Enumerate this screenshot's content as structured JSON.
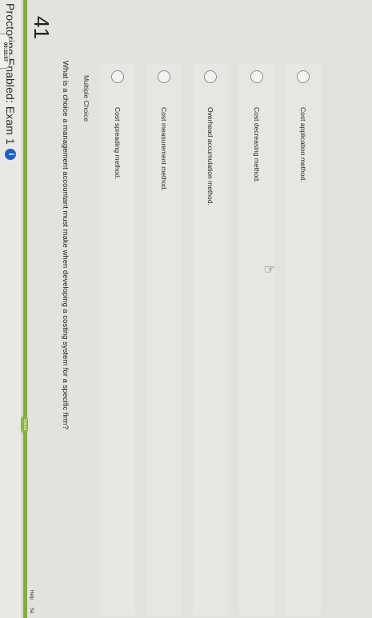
{
  "window": {
    "title": "Proctoring Enabled: Exam 1",
    "info_icon": "info-icon"
  },
  "header": {
    "saved_badge": "Saved",
    "help_link": "Help",
    "save_exit_link": "Sa"
  },
  "timer": {
    "value": "00:33:57"
  },
  "question": {
    "number": "41",
    "text": "What is a choice a management accountant must make when developing a costing system for a specific firm?",
    "type_label": "Multiple Choice",
    "options": [
      {
        "label": "Cost spreading method."
      },
      {
        "label": "Cost measurement method."
      },
      {
        "label": "Overhead accumulation method."
      },
      {
        "label": "Cost decreasing method."
      },
      {
        "label": "Cost application method."
      }
    ]
  },
  "colors": {
    "accent_green": "#7fae3a",
    "info_blue": "#1f5fbf"
  }
}
